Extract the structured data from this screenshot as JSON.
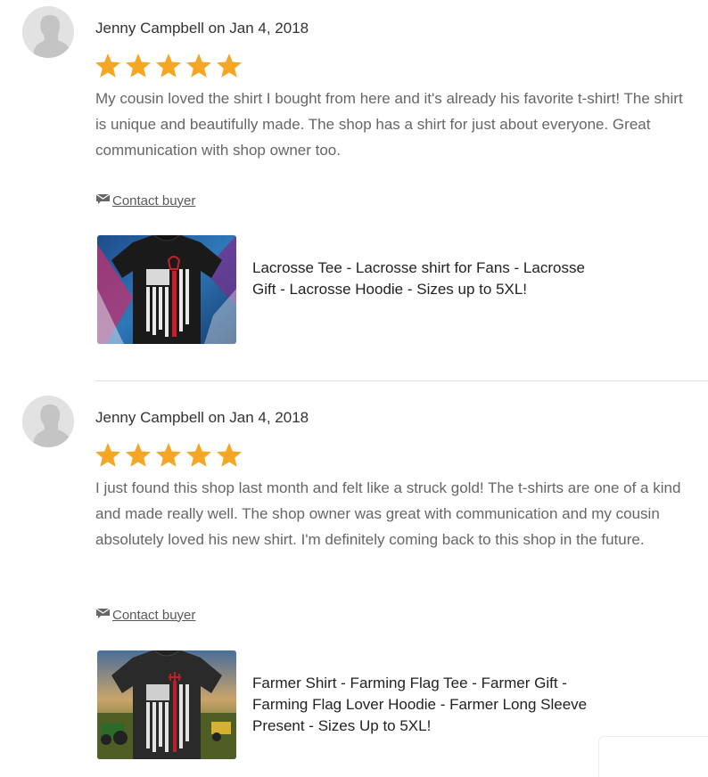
{
  "reviews": [
    {
      "author_line": "Jenny Campbell on Jan 4, 2018",
      "rating": 5,
      "rating_max": 5,
      "text": "My cousin loved the shirt I bought from here and it's already his favorite t-shirt! The shirt is unique and beautifully made. The shop has a shirt for just about everyone. Great communication with shop owner too.",
      "contact_label": "Contact buyer",
      "product_title": "Lacrosse Tee - Lacrosse shirt for Fans - Lacrosse Gift - Lacrosse Hoodie - Sizes up to 5XL!"
    },
    {
      "author_line": "Jenny Campbell on Jan 4, 2018",
      "rating": 5,
      "rating_max": 5,
      "text": "I just found this shop last month and felt like a struck gold! The t-shirts are one of a kind and made really well. The shop owner was great with communication and my cousin absolutely loved his new shirt. I'm definitely coming back to this shop in the future.",
      "contact_label": "Contact buyer",
      "product_title": "Farmer Shirt - Farming Flag Tee - Farmer Gift - Farming Flag Lover Hoodie - Farmer Long Sleeve Present - Sizes Up to 5XL!"
    }
  ],
  "colors": {
    "star": "#f5a623",
    "avatar_bg": "#e2e2e2",
    "avatar_figure": "#c4c4c4",
    "review_text": "#666666",
    "divider": "#e1e1e1"
  },
  "icons": {
    "avatar": "default-user-silhouette-icon",
    "star": "star-icon",
    "contact": "envelope-message-icon"
  }
}
